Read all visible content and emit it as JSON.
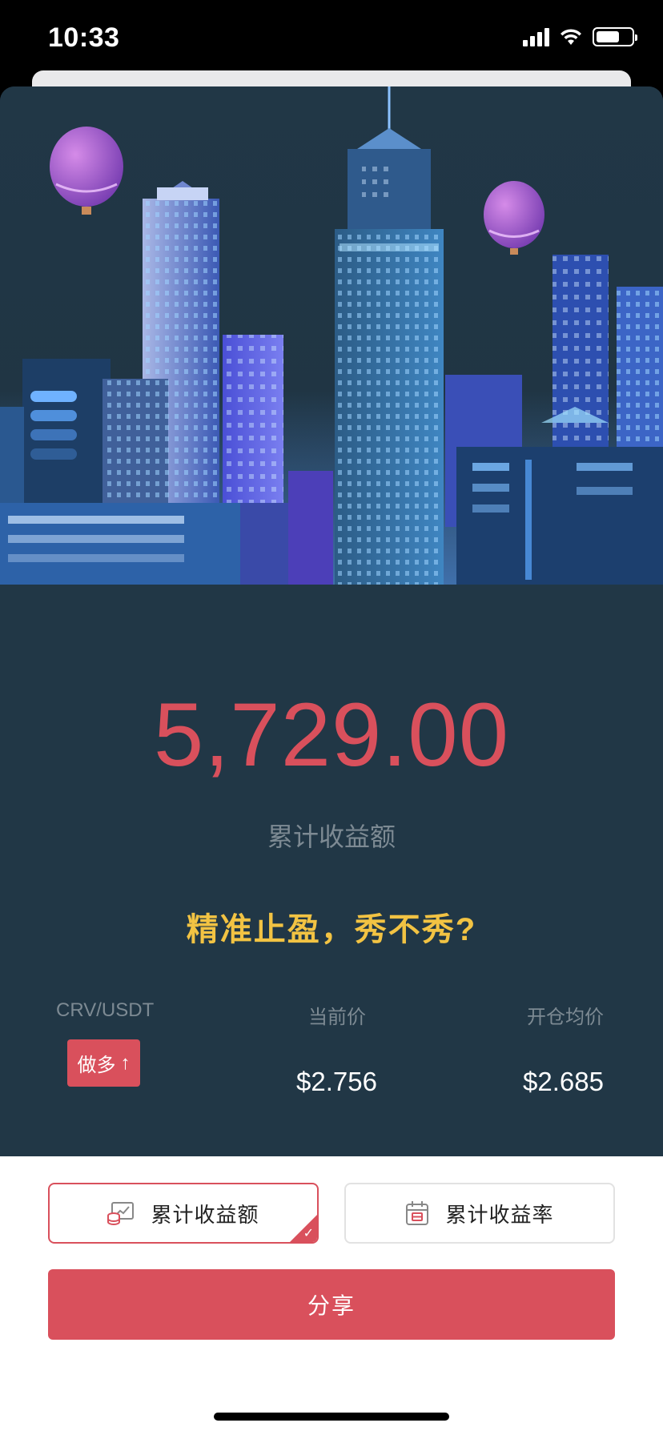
{
  "status_bar": {
    "time": "10:33"
  },
  "hero": {
    "amount": "5,729.00",
    "amount_label": "累计收益额",
    "slogan": "精准止盈，秀不秀?"
  },
  "position": {
    "pair": "CRV/USDT",
    "direction": "做多",
    "direction_arrow": "↑",
    "current_price_label": "当前价",
    "current_price": "$2.756",
    "avg_open_label": "开仓均价",
    "avg_open_price": "$2.685"
  },
  "options": {
    "left_label": "累计收益额",
    "right_label": "累计收益率",
    "selected": "left"
  },
  "share_label": "分享",
  "colors": {
    "card_bg": "#213746",
    "accent_red": "#d9505c",
    "slogan_yellow": "#f2c343"
  }
}
